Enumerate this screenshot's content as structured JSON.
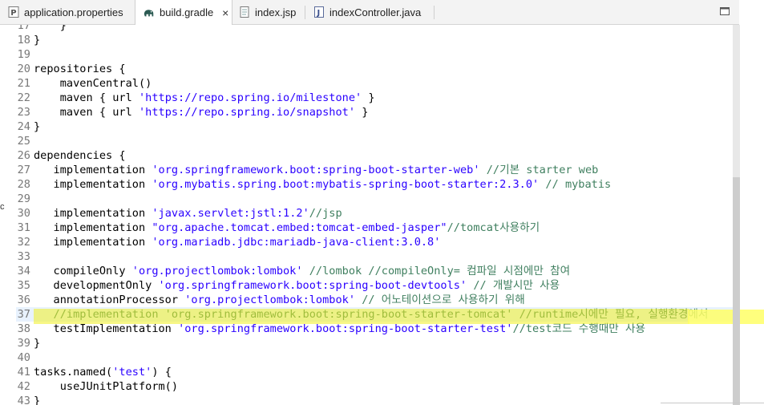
{
  "tabs": [
    {
      "label": "application.properties",
      "icon": "properties-file-icon",
      "active": false
    },
    {
      "label": "build.gradle",
      "icon": "gradle-elephant-icon",
      "active": true,
      "close": "×"
    },
    {
      "label": "index.jsp",
      "icon": "jsp-file-icon",
      "active": false
    },
    {
      "label": "indexController.java",
      "icon": "java-file-icon",
      "active": false
    }
  ],
  "edge_text": "c",
  "editor": {
    "lines": [
      {
        "n": "17",
        "parts": [
          {
            "t": "    }"
          }
        ]
      },
      {
        "n": "18",
        "parts": [
          {
            "t": "}"
          }
        ]
      },
      {
        "n": "19",
        "parts": [
          {
            "t": ""
          }
        ]
      },
      {
        "n": "20",
        "parts": [
          {
            "t": "repositories {"
          }
        ]
      },
      {
        "n": "21",
        "parts": [
          {
            "t": "    mavenCentral()"
          }
        ]
      },
      {
        "n": "22",
        "parts": [
          {
            "t": "    maven { url "
          },
          {
            "t": "'https://repo.spring.io/milestone'",
            "c": "s"
          },
          {
            "t": " }"
          }
        ]
      },
      {
        "n": "23",
        "parts": [
          {
            "t": "    maven { url "
          },
          {
            "t": "'https://repo.spring.io/snapshot'",
            "c": "s"
          },
          {
            "t": " }"
          }
        ]
      },
      {
        "n": "24",
        "parts": [
          {
            "t": "}"
          }
        ]
      },
      {
        "n": "25",
        "parts": [
          {
            "t": ""
          }
        ]
      },
      {
        "n": "26",
        "parts": [
          {
            "t": "dependencies {"
          }
        ]
      },
      {
        "n": "27",
        "parts": [
          {
            "t": "   implementation "
          },
          {
            "t": "'org.springframework.boot:spring-boot-starter-web'",
            "c": "s"
          },
          {
            "t": " //기본 starter web",
            "c": "c"
          }
        ]
      },
      {
        "n": "28",
        "parts": [
          {
            "t": "   implementation "
          },
          {
            "t": "'org.mybatis.spring.boot:mybatis-spring-boot-starter:2.3.0'",
            "c": "s"
          },
          {
            "t": " // mybatis",
            "c": "c"
          }
        ]
      },
      {
        "n": "29",
        "parts": [
          {
            "t": ""
          }
        ]
      },
      {
        "n": "30",
        "parts": [
          {
            "t": "   implementation "
          },
          {
            "t": "'javax.servlet:jstl:1.2'",
            "c": "s"
          },
          {
            "t": "//jsp",
            "c": "c"
          }
        ]
      },
      {
        "n": "31",
        "parts": [
          {
            "t": "   implementation "
          },
          {
            "t": "\"org.apache.tomcat.embed:tomcat-embed-jasper\"",
            "c": "s"
          },
          {
            "t": "//tomcat사용하기",
            "c": "c"
          }
        ]
      },
      {
        "n": "32",
        "parts": [
          {
            "t": "   implementation "
          },
          {
            "t": "'org.mariadb.jdbc:mariadb-java-client:3.0.8'",
            "c": "s"
          }
        ]
      },
      {
        "n": "33",
        "parts": [
          {
            "t": ""
          }
        ]
      },
      {
        "n": "34",
        "parts": [
          {
            "t": "   compileOnly "
          },
          {
            "t": "'org.projectlombok:lombok'",
            "c": "s"
          },
          {
            "t": " //lombok //compileOnly= 컴파일 시점에만 참여",
            "c": "c"
          }
        ]
      },
      {
        "n": "35",
        "parts": [
          {
            "t": "   developmentOnly "
          },
          {
            "t": "'org.springframework.boot:spring-boot-devtools'",
            "c": "s"
          },
          {
            "t": " // 개발시만 사용",
            "c": "c"
          }
        ]
      },
      {
        "n": "36",
        "parts": [
          {
            "t": "   annotationProcessor "
          },
          {
            "t": "'org.projectlombok:lombok'",
            "c": "s"
          },
          {
            "t": " // 어노테이션으로 사용하기 위해",
            "c": "c"
          }
        ]
      },
      {
        "n": "37",
        "hl": true,
        "parts": [
          {
            "t": "   //implementation 'org.springframework.boot:spring-boot-starter-tomcat' //runtime시에만 필요, 실행환경에서",
            "c": "c"
          }
        ]
      },
      {
        "n": "38",
        "parts": [
          {
            "t": "   testImplementation "
          },
          {
            "t": "'org.springframework.boot:spring-boot-starter-test'",
            "c": "s"
          },
          {
            "t": "//test코드 수행때만 사용",
            "c": "c"
          }
        ]
      },
      {
        "n": "39",
        "parts": [
          {
            "t": "}"
          }
        ]
      },
      {
        "n": "40",
        "parts": [
          {
            "t": ""
          }
        ]
      },
      {
        "n": "41",
        "parts": [
          {
            "t": "tasks.named("
          },
          {
            "t": "'test'",
            "c": "s"
          },
          {
            "t": ") {"
          }
        ]
      },
      {
        "n": "42",
        "parts": [
          {
            "t": "    useJUnitPlatform()"
          }
        ]
      },
      {
        "n": "43",
        "parts": [
          {
            "t": "}"
          }
        ]
      }
    ]
  }
}
